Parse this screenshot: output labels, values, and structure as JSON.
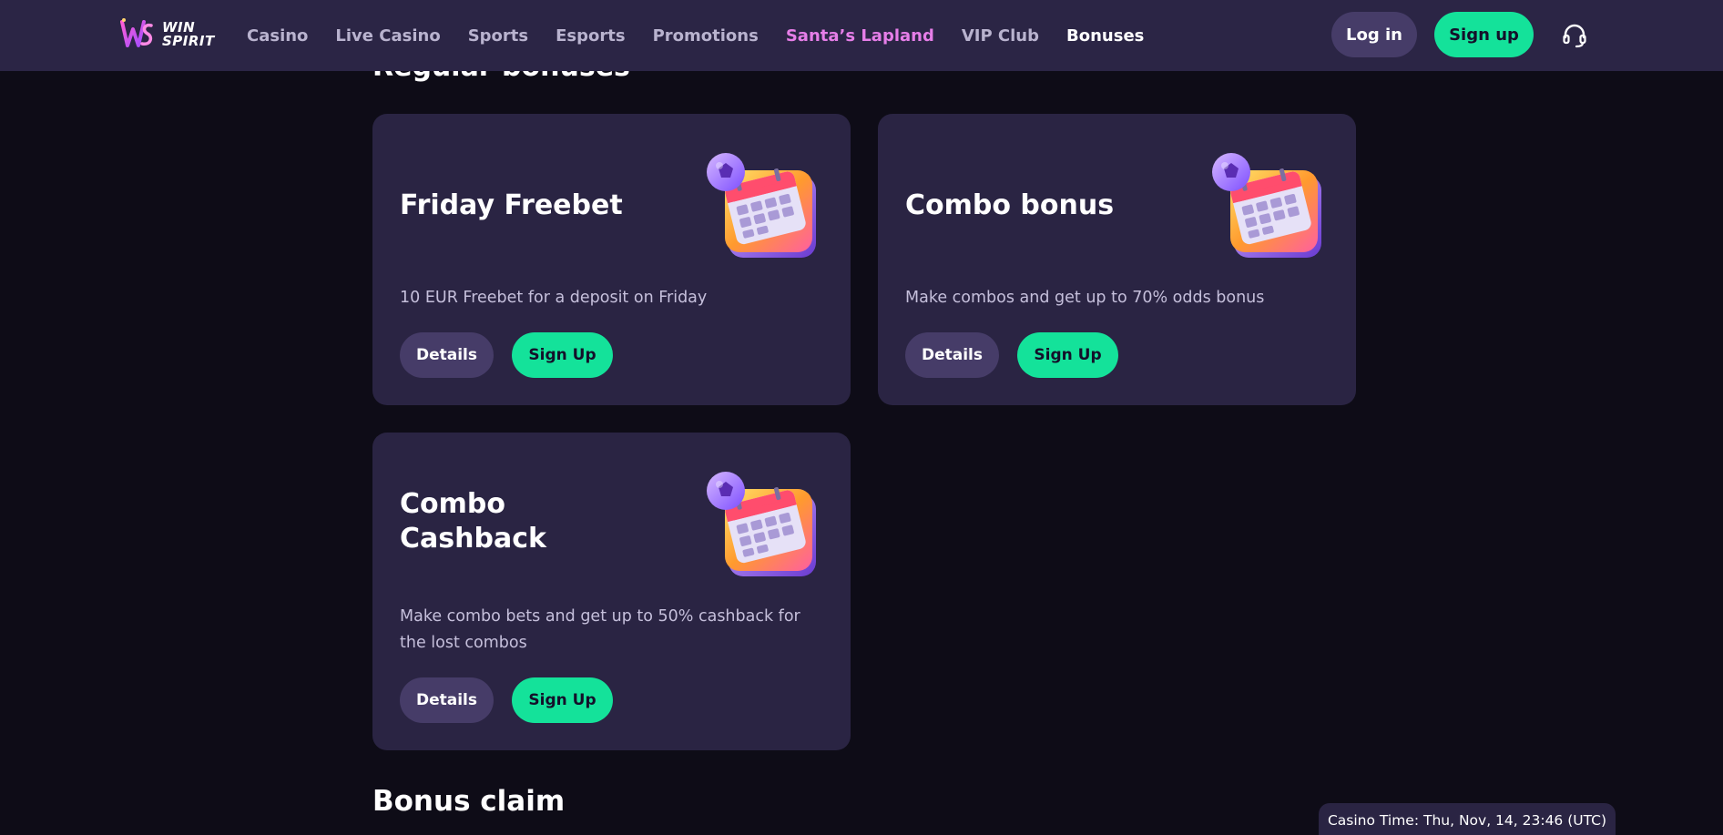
{
  "header": {
    "logo_line1": "WIN",
    "logo_line2": "SPIRIT",
    "nav": [
      {
        "label": "Casino"
      },
      {
        "label": "Live Casino"
      },
      {
        "label": "Sports"
      },
      {
        "label": "Esports"
      },
      {
        "label": "Promotions"
      },
      {
        "label": "Santa’s Lapland"
      },
      {
        "label": "VIP Club"
      },
      {
        "label": "Bonuses"
      }
    ],
    "login_label": "Log in",
    "signup_label": "Sign up",
    "support_icon": "headset-icon"
  },
  "section_title": "Regular bonuses",
  "cards": [
    {
      "title": "Friday Freebet",
      "description": "10 EUR Freebet for a deposit on Friday",
      "details_label": "Details",
      "signup_label": "Sign Up",
      "icon": "calendar-football-icon"
    },
    {
      "title": "Combo bonus",
      "description": "Make combos and get up to 70% odds bonus",
      "details_label": "Details",
      "signup_label": "Sign Up",
      "icon": "calendar-football-icon"
    },
    {
      "title": "Combo Cashback",
      "description": "Make combo bets and get up to 50% cashback for the lost combos",
      "details_label": "Details",
      "signup_label": "Sign Up",
      "icon": "calendar-football-icon"
    }
  ],
  "bonus_claim_title": "Bonus claim",
  "casino_time": "Casino Time: Thu, Nov, 14, 23:46 (UTC)",
  "colors": {
    "background": "#0e0c17",
    "header": "#2b2545",
    "card": "#2a2443",
    "accent_green": "#14e29a",
    "button_secondary": "#463c68",
    "nav_highlight": "#e67ee8"
  }
}
